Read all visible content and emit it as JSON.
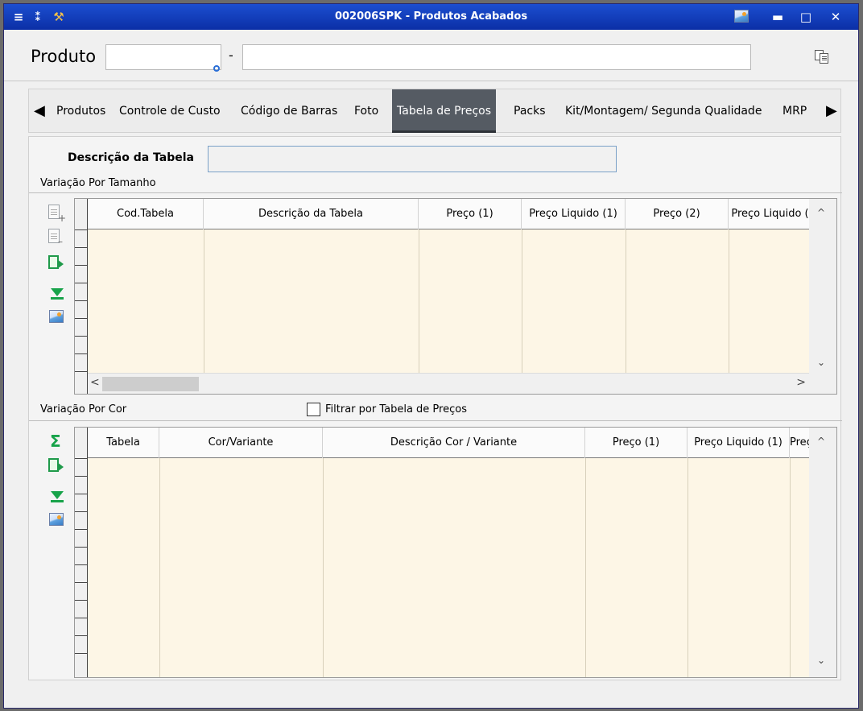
{
  "window": {
    "title": "002006SPK - Produtos Acabados"
  },
  "product": {
    "label": "Produto",
    "dash": "-",
    "code_value": "",
    "description_value": ""
  },
  "tabs": [
    {
      "label": "Produtos"
    },
    {
      "label": "Controle de Custo"
    },
    {
      "label": "Código de Barras"
    },
    {
      "label": "Foto"
    },
    {
      "label": "Tabela de Preços",
      "active": true
    },
    {
      "label": "Packs"
    },
    {
      "label": "Kit/Montagem/ Segunda Qualidade"
    },
    {
      "label": "MRP"
    }
  ],
  "tab_arrows": {
    "left": "◀",
    "right": "▶"
  },
  "panel": {
    "desc_label": "Descrição da Tabela",
    "desc_value": "",
    "size_section": "Variação Por Tamanho",
    "color_section": "Variação Por Cor",
    "filter_label": "Filtrar por Tabela de Preços",
    "filter_checked": false
  },
  "size_grid": {
    "columns": [
      "Cod.Tabela",
      "Descrição da Tabela",
      "Preço (1)",
      "Preço Liquido (1)",
      "Preço (2)",
      "Preço Liquido ("
    ]
  },
  "color_grid": {
    "columns": [
      "Tabela",
      "Cor/Variante",
      "Descrição Cor / Variante",
      "Preço (1)",
      "Preço Liquido (1)",
      "Preç"
    ]
  },
  "scroll_glyphs": {
    "up": "^",
    "down": "⌄",
    "left": "<",
    "right": ">"
  },
  "colors": {
    "titlebar": "#1c4fd0",
    "active_tab": "#555b63",
    "grid_bg": "#fdf6e6"
  }
}
